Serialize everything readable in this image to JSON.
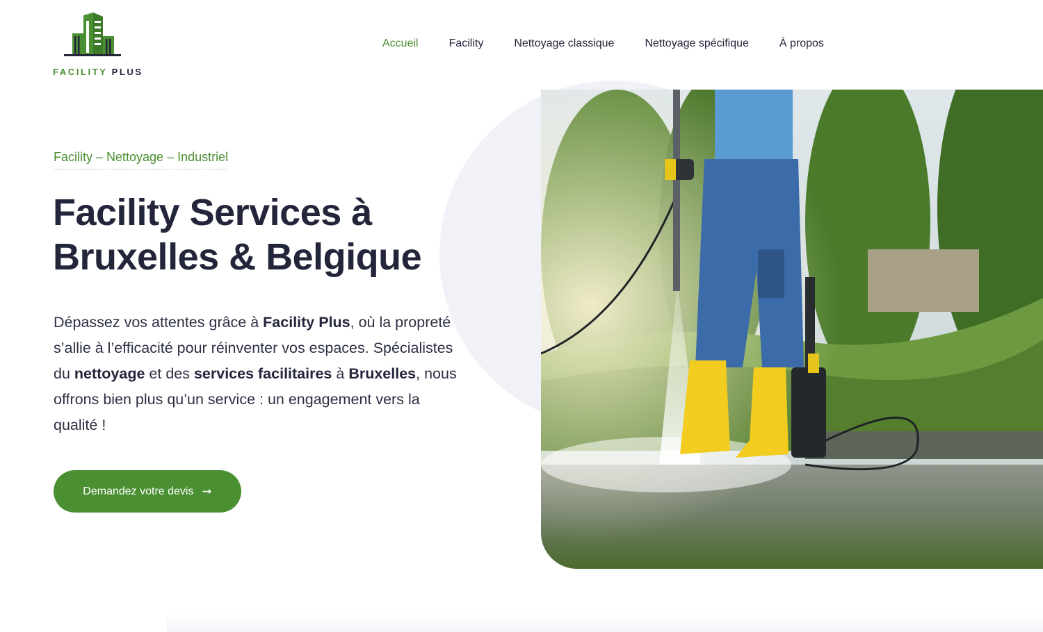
{
  "brand": {
    "name_part1": "FACILITY",
    "name_part2": "PLUS",
    "accent_color": "#4a8f31",
    "dark_color": "#23253a",
    "logo_icon": "buildings-logo-icon"
  },
  "nav": {
    "items": [
      {
        "label": "Accueil",
        "active": true
      },
      {
        "label": "Facility",
        "active": false
      },
      {
        "label": "Nettoyage classique",
        "active": false
      },
      {
        "label": "Nettoyage spécifique",
        "active": false
      },
      {
        "label": "À propos",
        "active": false
      }
    ]
  },
  "hero": {
    "eyebrow": "Facility – Nettoyage – Industriel",
    "headline_line1": "Facility Services à",
    "headline_line2": "Bruxelles & Belgique",
    "paragraph": {
      "t1": "Dépassez vos attentes grâce à ",
      "b1": "Facility Plus",
      "t2": ", où la propreté s’allie à l’efficacité pour réinventer vos espaces. Spécialistes du ",
      "b2": "nettoyage",
      "t3": " et des ",
      "b3": "services facilitaires",
      "t4": " à ",
      "b4": "Bruxelles",
      "t5": ", nous offrons bien plus qu’un service : un engagement vers la qualité !"
    },
    "cta_label": "Demandez votre devis",
    "cta_icon": "arrow-right-icon",
    "image_icon": "pressure-washer-worker-photo"
  }
}
